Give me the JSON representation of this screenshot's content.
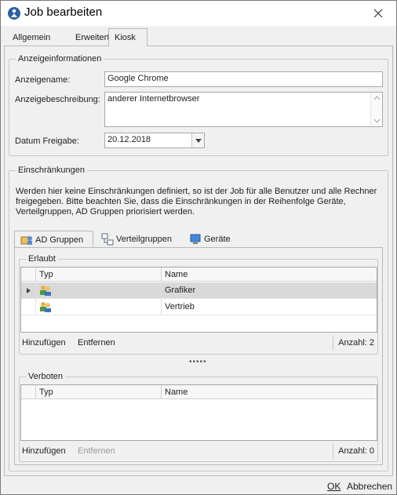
{
  "window": {
    "title": "Job bearbeiten"
  },
  "tabs": [
    {
      "label": "Allgemein"
    },
    {
      "label": "Erweitert"
    },
    {
      "label": "Kiosk"
    }
  ],
  "display_info": {
    "legend": "Anzeigeinformationen",
    "name_label": "Anzeigename:",
    "name_value": "Google Chrome",
    "desc_label": "Anzeigebeschreibung:",
    "desc_value": "anderer Internetbrowser",
    "date_label": "Datum Freigabe:",
    "date_value": "20.12.2018"
  },
  "restrictions": {
    "legend": "Einschränkungen",
    "info_line1": "Werden hier keine Einschränkungen definiert, so ist der Job für alle Benutzer und alle Rechner",
    "info_line2": "freigegeben. Bitte beachten Sie, dass die Einschränkungen in der Reihenfolge Geräte,",
    "info_line3": "Verteilgruppen, AD Gruppen priorisiert werden.",
    "subtabs": [
      {
        "label": "AD Gruppen"
      },
      {
        "label": "Verteilgruppen"
      },
      {
        "label": "Geräte"
      }
    ],
    "allowed": {
      "legend": "Erlaubt",
      "col_type": "Typ",
      "col_name": "Name",
      "rows": [
        {
          "name": "Grafiker"
        },
        {
          "name": "Vertrieb"
        }
      ],
      "add": "Hinzufügen",
      "remove": "Entfernen",
      "count": "Anzahl: 2"
    },
    "splitter": "•••••",
    "forbidden": {
      "legend": "Verboten",
      "col_type": "Typ",
      "col_name": "Name",
      "add": "Hinzufügen",
      "remove": "Entfernen",
      "count": "Anzahl: 0"
    }
  },
  "footer": {
    "ok": "OK",
    "cancel": "Abbrechen"
  }
}
